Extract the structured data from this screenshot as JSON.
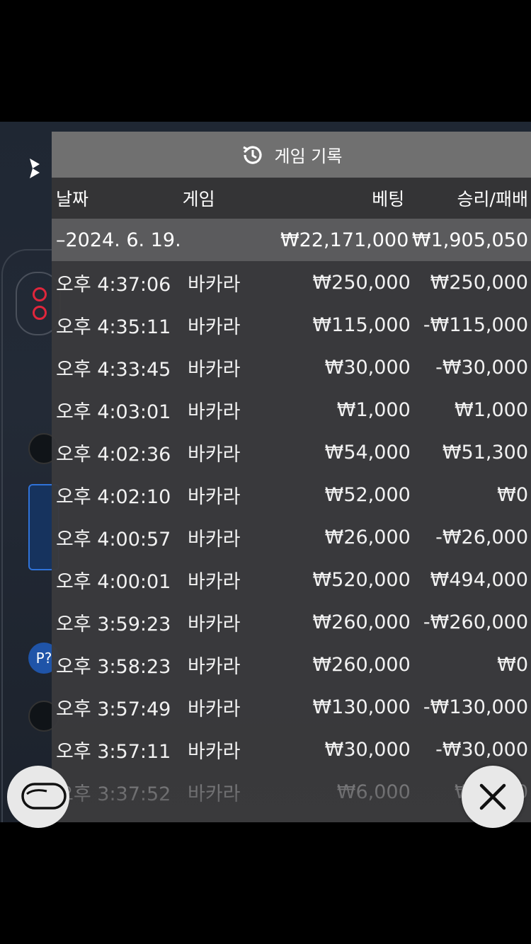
{
  "header": {
    "title": "게임 기록",
    "icon": "history-icon"
  },
  "columns": {
    "date": "날짜",
    "game": "게임",
    "bet": "베팅",
    "win": "승리/패배"
  },
  "summary": {
    "date": "–2024. 6. 19.",
    "bet": "₩22,171,000",
    "win": "₩1,905,050"
  },
  "rows": [
    {
      "time": "오후 4:37:06",
      "game": "바카라",
      "bet": "₩250,000",
      "win": "₩250,000"
    },
    {
      "time": "오후 4:35:11",
      "game": "바카라",
      "bet": "₩115,000",
      "win": "-₩115,000"
    },
    {
      "time": "오후 4:33:45",
      "game": "바카라",
      "bet": "₩30,000",
      "win": "-₩30,000"
    },
    {
      "time": "오후 4:03:01",
      "game": "바카라",
      "bet": "₩1,000",
      "win": "₩1,000"
    },
    {
      "time": "오후 4:02:36",
      "game": "바카라",
      "bet": "₩54,000",
      "win": "₩51,300"
    },
    {
      "time": "오후 4:02:10",
      "game": "바카라",
      "bet": "₩52,000",
      "win": "₩0"
    },
    {
      "time": "오후 4:00:57",
      "game": "바카라",
      "bet": "₩26,000",
      "win": "-₩26,000"
    },
    {
      "time": "오후 4:00:01",
      "game": "바카라",
      "bet": "₩520,000",
      "win": "₩494,000"
    },
    {
      "time": "오후 3:59:23",
      "game": "바카라",
      "bet": "₩260,000",
      "win": "-₩260,000"
    },
    {
      "time": "오후 3:58:23",
      "game": "바카라",
      "bet": "₩260,000",
      "win": "₩0"
    },
    {
      "time": "오후 3:57:49",
      "game": "바카라",
      "bet": "₩130,000",
      "win": "-₩130,000"
    },
    {
      "time": "오후 3:57:11",
      "game": "바카라",
      "bet": "₩30,000",
      "win": "-₩30,000"
    },
    {
      "time": "오후 3:37:52",
      "game": "바카라",
      "bet": "₩6,000",
      "win": "₩5,700"
    }
  ],
  "background": {
    "p_button": "P?"
  },
  "colors": {
    "header_bg": "#707070",
    "modal_bg": "#3a3a3c",
    "summary_bg": "#5b5b5d",
    "accent_red": "#e0263c",
    "accent_blue": "#2f72d8"
  }
}
